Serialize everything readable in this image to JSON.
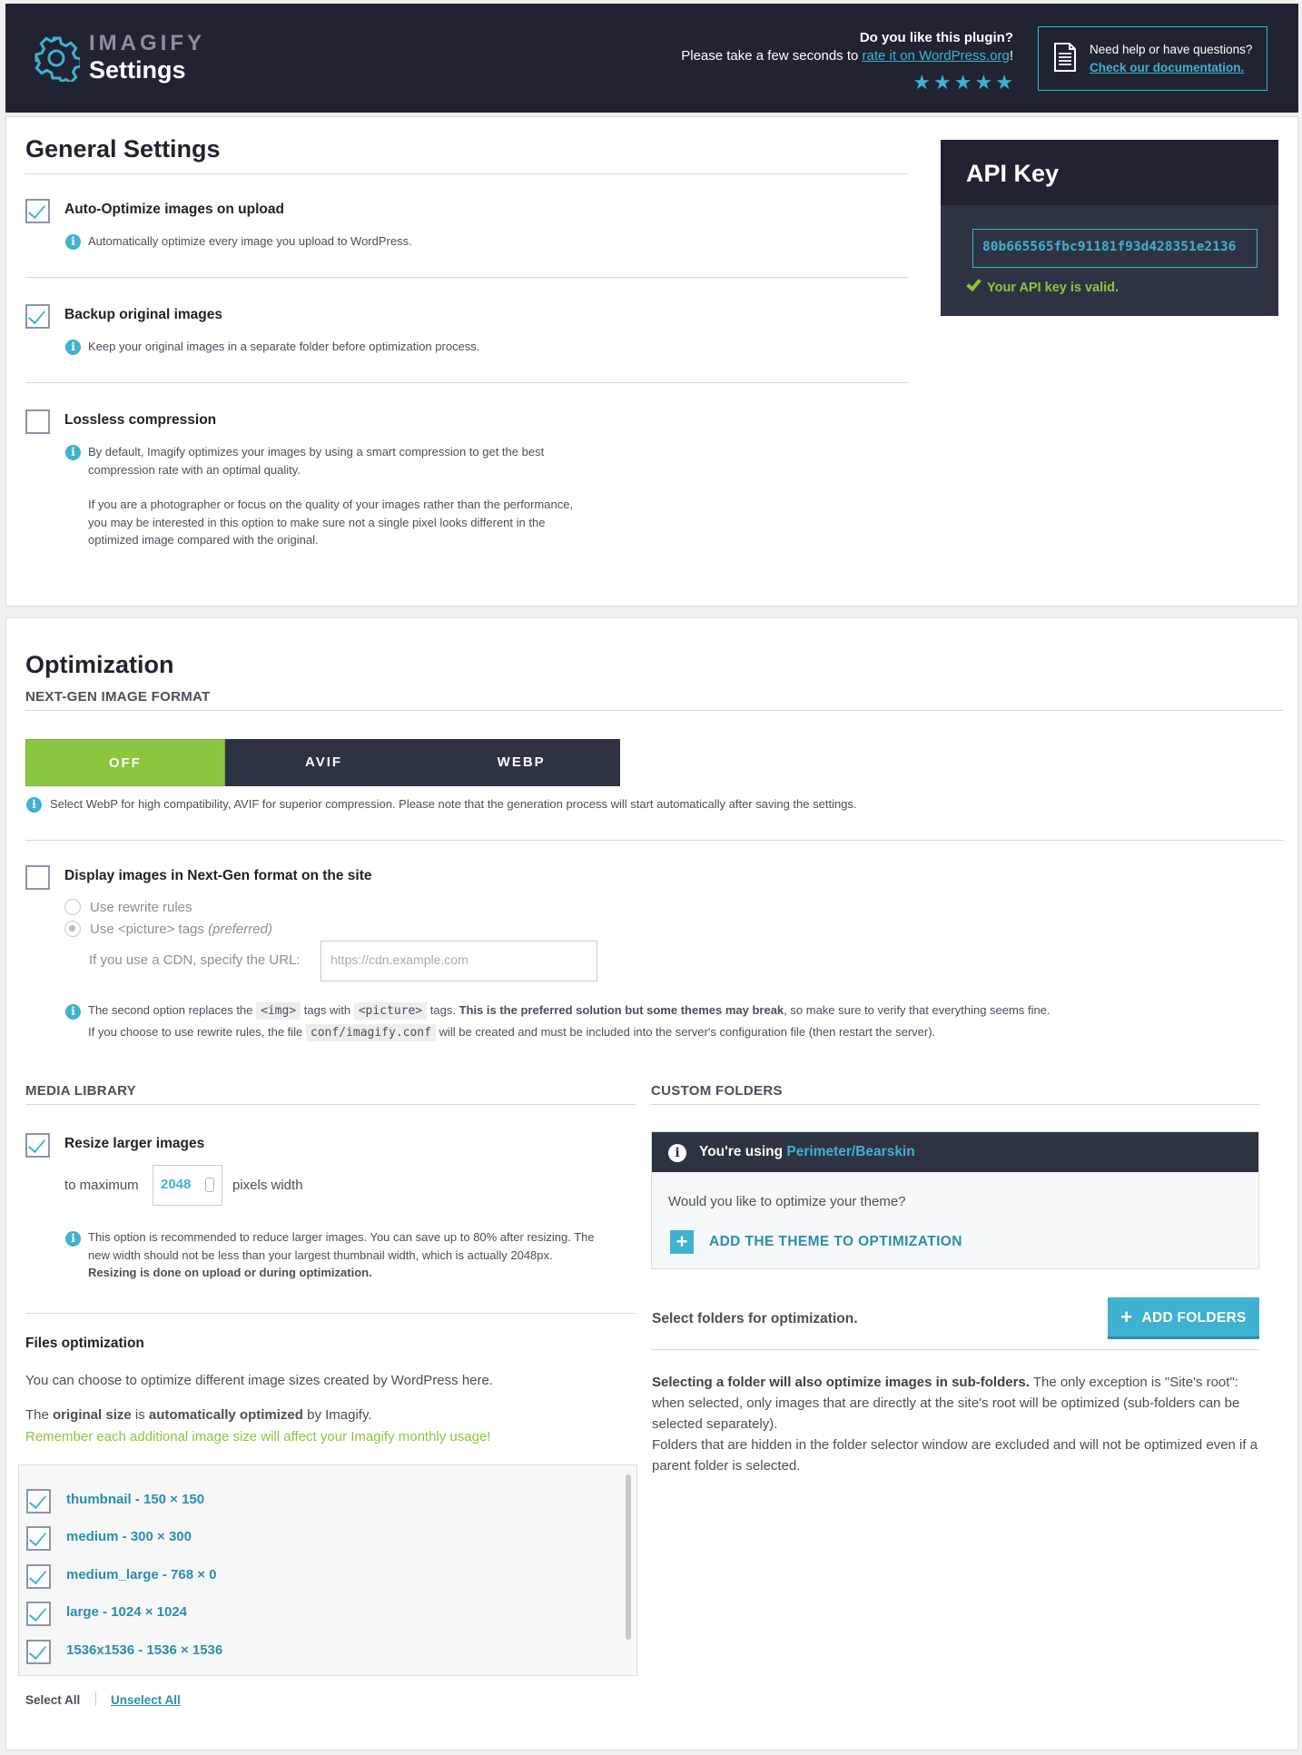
{
  "header": {
    "logo": "IMAGIFY",
    "title": "Settings",
    "rate_question": "Do you like this plugin?",
    "rate_prefix": "Please take a few seconds to ",
    "rate_link": "rate it on WordPress.org",
    "rate_suffix": "!",
    "stars": 5,
    "help_text": "Need help or have questions?",
    "help_link": "Check our documentation.",
    "icons": [
      "gear-icon",
      "document-icon",
      "star-icon"
    ]
  },
  "general": {
    "title": "General Settings",
    "auto_optimize": {
      "label": "Auto-Optimize images on upload",
      "checked": true,
      "desc": "Automatically optimize every image you upload to WordPress."
    },
    "backup": {
      "label": "Backup original images",
      "checked": true,
      "desc": "Keep your original images in a separate folder before optimization process."
    },
    "lossless": {
      "label": "Lossless compression",
      "checked": false,
      "desc_1": "By default, Imagify optimizes your images by using a smart compression to get the best",
      "desc_2": "compression rate with an optimal quality.",
      "desc_3": "If you are a photographer or focus on the quality of your images rather than the performance,",
      "desc_4": "you may be interested in this option to make sure not a single pixel looks different in the",
      "desc_5": "optimized image compared with the original."
    }
  },
  "api_key": {
    "title": "API Key",
    "value": "80b665565fbc91181f93d428351e2136",
    "status": "Your API key is valid."
  },
  "optimization": {
    "title": "Optimization",
    "nextgen_heading": "NEXT-GEN IMAGE FORMAT",
    "format_options": [
      "OFF",
      "AVIF",
      "WEBP"
    ],
    "format_selected": "OFF",
    "format_note": "Select WebP for high compatibility, AVIF for superior compression. Please note that the generation process will start automatically after saving the settings.",
    "display_nextgen": {
      "label": "Display images in Next-Gen format on the site",
      "checked": false
    },
    "radio_rewrite": "Use rewrite rules",
    "radio_picture": "Use <picture> tags ",
    "radio_picture_pref": "(preferred)",
    "cdn_label": "If you use a CDN, specify the URL:",
    "cdn_placeholder": "https://cdn.example.com",
    "note_a": "The second option replaces the ",
    "code_img": "<img>",
    "note_b": " tags with ",
    "code_picture": "<picture>",
    "note_c": " tags. ",
    "note_bold": "This is the preferred solution but some themes may break",
    "note_d": ", so make sure to verify that everything seems fine.",
    "note_e": "If you choose to use rewrite rules, the file ",
    "code_conf": "conf/imagify.conf",
    "note_f": " will be created and must be included into the server's configuration file (then restart the server)."
  },
  "media_library": {
    "heading": "MEDIA LIBRARY",
    "resize": {
      "label": "Resize larger images",
      "checked": true
    },
    "to_maximum": "to maximum",
    "max_width": "2048",
    "pixels_width": "pixels width",
    "resize_note_1": "This option is recommended to reduce larger images. You can save up to 80% after resizing. The",
    "resize_note_2": "new width should not be less than your largest thumbnail width, which is actually 2048px.",
    "resize_note_3": "Resizing is done on upload or during optimization.",
    "files_heading": "Files optimization",
    "files_intro": "You can choose to optimize different image sizes created by WordPress here.",
    "orig_a": "The ",
    "orig_b": "original size",
    "orig_c": " is ",
    "orig_d": "automatically optimized",
    "orig_e": " by Imagify.",
    "warning": "Remember each additional image size will affect your Imagify monthly usage!",
    "sizes": [
      {
        "label": "thumbnail - 150 × 150",
        "checked": true
      },
      {
        "label": "medium - 300 × 300",
        "checked": true
      },
      {
        "label": "medium_large - 768 × 0",
        "checked": true
      },
      {
        "label": "large - 1024 × 1024",
        "checked": true
      },
      {
        "label": "1536x1536 - 1536 × 1536",
        "checked": true
      }
    ],
    "select_all": "Select All",
    "unselect_all": "Unselect All"
  },
  "custom_folders": {
    "heading": "CUSTOM FOLDERS",
    "using_prefix": "You're using ",
    "theme_name": "Perimeter/Bearskin",
    "question": "Would you like to optimize your theme?",
    "add_theme": "ADD THE THEME TO OPTIMIZATION",
    "select_label": "Select folders for optimization.",
    "add_folders": "ADD FOLDERS",
    "text_bold": "Selecting a folder will also optimize images in sub-folders.",
    "text_1": " The only exception is \"Site's root\": when selected, only images that are directly at the site's root will be optimized (sub-folders can be selected separately).",
    "text_2": "Folders that are hidden in the folder selector window are excluded and will not be optimized even if a parent folder is selected."
  },
  "colors": {
    "accent": "#40b1d0",
    "green": "#8cc540",
    "dark": "#1f2332"
  }
}
